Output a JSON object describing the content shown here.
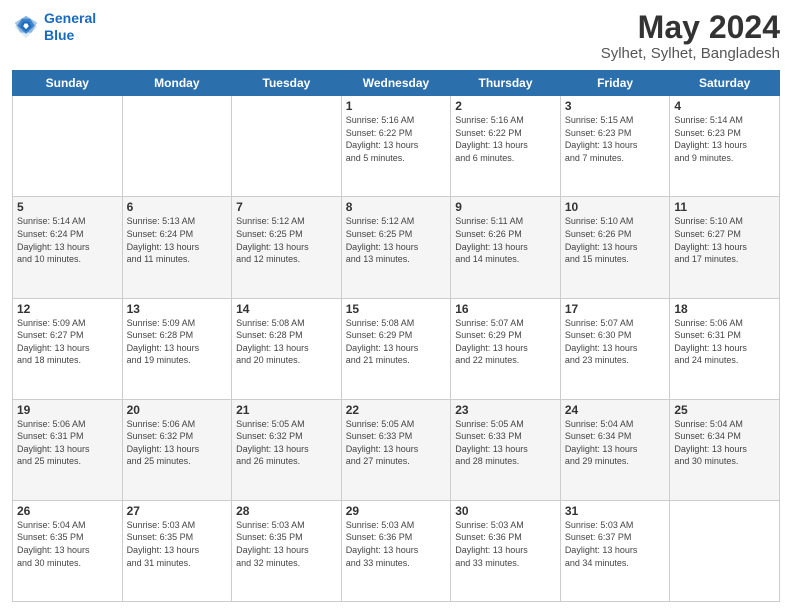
{
  "logo": {
    "line1": "General",
    "line2": "Blue"
  },
  "title": "May 2024",
  "subtitle": "Sylhet, Sylhet, Bangladesh",
  "days_of_week": [
    "Sunday",
    "Monday",
    "Tuesday",
    "Wednesday",
    "Thursday",
    "Friday",
    "Saturday"
  ],
  "weeks": [
    [
      {
        "day": "",
        "info": ""
      },
      {
        "day": "",
        "info": ""
      },
      {
        "day": "",
        "info": ""
      },
      {
        "day": "1",
        "info": "Sunrise: 5:16 AM\nSunset: 6:22 PM\nDaylight: 13 hours\nand 5 minutes."
      },
      {
        "day": "2",
        "info": "Sunrise: 5:16 AM\nSunset: 6:22 PM\nDaylight: 13 hours\nand 6 minutes."
      },
      {
        "day": "3",
        "info": "Sunrise: 5:15 AM\nSunset: 6:23 PM\nDaylight: 13 hours\nand 7 minutes."
      },
      {
        "day": "4",
        "info": "Sunrise: 5:14 AM\nSunset: 6:23 PM\nDaylight: 13 hours\nand 9 minutes."
      }
    ],
    [
      {
        "day": "5",
        "info": "Sunrise: 5:14 AM\nSunset: 6:24 PM\nDaylight: 13 hours\nand 10 minutes."
      },
      {
        "day": "6",
        "info": "Sunrise: 5:13 AM\nSunset: 6:24 PM\nDaylight: 13 hours\nand 11 minutes."
      },
      {
        "day": "7",
        "info": "Sunrise: 5:12 AM\nSunset: 6:25 PM\nDaylight: 13 hours\nand 12 minutes."
      },
      {
        "day": "8",
        "info": "Sunrise: 5:12 AM\nSunset: 6:25 PM\nDaylight: 13 hours\nand 13 minutes."
      },
      {
        "day": "9",
        "info": "Sunrise: 5:11 AM\nSunset: 6:26 PM\nDaylight: 13 hours\nand 14 minutes."
      },
      {
        "day": "10",
        "info": "Sunrise: 5:10 AM\nSunset: 6:26 PM\nDaylight: 13 hours\nand 15 minutes."
      },
      {
        "day": "11",
        "info": "Sunrise: 5:10 AM\nSunset: 6:27 PM\nDaylight: 13 hours\nand 17 minutes."
      }
    ],
    [
      {
        "day": "12",
        "info": "Sunrise: 5:09 AM\nSunset: 6:27 PM\nDaylight: 13 hours\nand 18 minutes."
      },
      {
        "day": "13",
        "info": "Sunrise: 5:09 AM\nSunset: 6:28 PM\nDaylight: 13 hours\nand 19 minutes."
      },
      {
        "day": "14",
        "info": "Sunrise: 5:08 AM\nSunset: 6:28 PM\nDaylight: 13 hours\nand 20 minutes."
      },
      {
        "day": "15",
        "info": "Sunrise: 5:08 AM\nSunset: 6:29 PM\nDaylight: 13 hours\nand 21 minutes."
      },
      {
        "day": "16",
        "info": "Sunrise: 5:07 AM\nSunset: 6:29 PM\nDaylight: 13 hours\nand 22 minutes."
      },
      {
        "day": "17",
        "info": "Sunrise: 5:07 AM\nSunset: 6:30 PM\nDaylight: 13 hours\nand 23 minutes."
      },
      {
        "day": "18",
        "info": "Sunrise: 5:06 AM\nSunset: 6:31 PM\nDaylight: 13 hours\nand 24 minutes."
      }
    ],
    [
      {
        "day": "19",
        "info": "Sunrise: 5:06 AM\nSunset: 6:31 PM\nDaylight: 13 hours\nand 25 minutes."
      },
      {
        "day": "20",
        "info": "Sunrise: 5:06 AM\nSunset: 6:32 PM\nDaylight: 13 hours\nand 25 minutes."
      },
      {
        "day": "21",
        "info": "Sunrise: 5:05 AM\nSunset: 6:32 PM\nDaylight: 13 hours\nand 26 minutes."
      },
      {
        "day": "22",
        "info": "Sunrise: 5:05 AM\nSunset: 6:33 PM\nDaylight: 13 hours\nand 27 minutes."
      },
      {
        "day": "23",
        "info": "Sunrise: 5:05 AM\nSunset: 6:33 PM\nDaylight: 13 hours\nand 28 minutes."
      },
      {
        "day": "24",
        "info": "Sunrise: 5:04 AM\nSunset: 6:34 PM\nDaylight: 13 hours\nand 29 minutes."
      },
      {
        "day": "25",
        "info": "Sunrise: 5:04 AM\nSunset: 6:34 PM\nDaylight: 13 hours\nand 30 minutes."
      }
    ],
    [
      {
        "day": "26",
        "info": "Sunrise: 5:04 AM\nSunset: 6:35 PM\nDaylight: 13 hours\nand 30 minutes."
      },
      {
        "day": "27",
        "info": "Sunrise: 5:03 AM\nSunset: 6:35 PM\nDaylight: 13 hours\nand 31 minutes."
      },
      {
        "day": "28",
        "info": "Sunrise: 5:03 AM\nSunset: 6:35 PM\nDaylight: 13 hours\nand 32 minutes."
      },
      {
        "day": "29",
        "info": "Sunrise: 5:03 AM\nSunset: 6:36 PM\nDaylight: 13 hours\nand 33 minutes."
      },
      {
        "day": "30",
        "info": "Sunrise: 5:03 AM\nSunset: 6:36 PM\nDaylight: 13 hours\nand 33 minutes."
      },
      {
        "day": "31",
        "info": "Sunrise: 5:03 AM\nSunset: 6:37 PM\nDaylight: 13 hours\nand 34 minutes."
      },
      {
        "day": "",
        "info": ""
      }
    ]
  ]
}
